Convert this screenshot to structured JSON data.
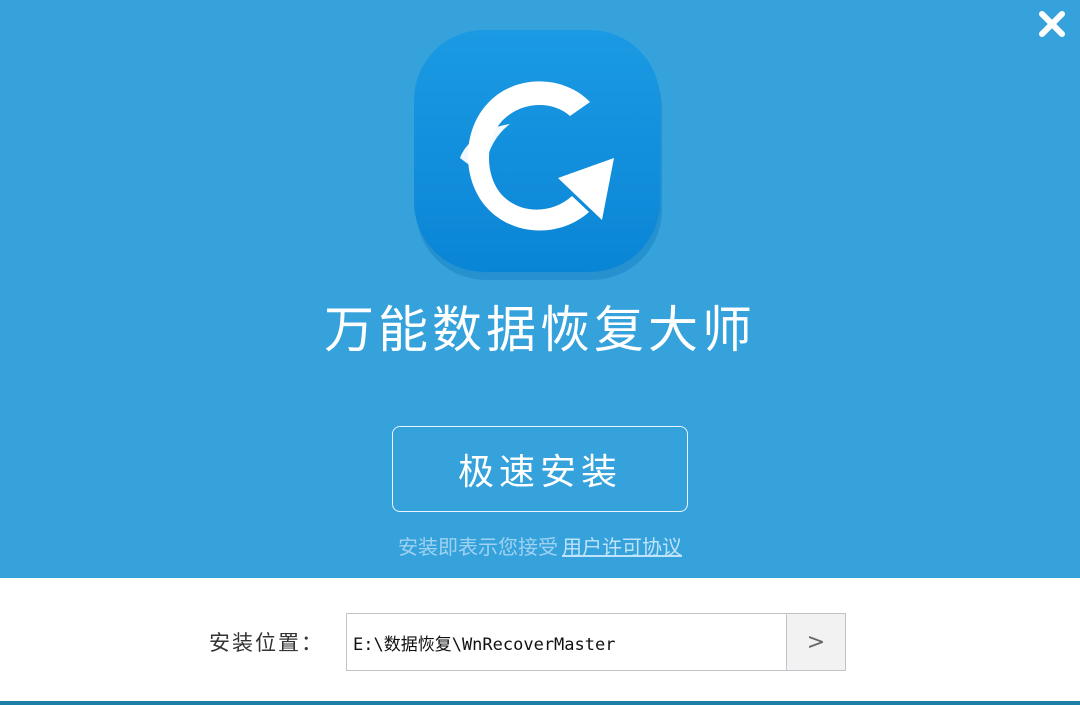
{
  "window": {
    "close_icon": "close-icon"
  },
  "header": {
    "app_icon": "refresh-recovery-icon",
    "title": "万能数据恢复大师"
  },
  "install": {
    "button_label": "极速安装",
    "agreement_text": "安装即表示您接受",
    "agreement_link": "用户许可协议"
  },
  "location": {
    "label": "安装位置：",
    "path": "E:\\数据恢复\\WnRecoverMaster",
    "browse_label": ">"
  },
  "colors": {
    "accent": "#35a2dc",
    "icon_tile": "#168fdc",
    "text_dark": "#333333"
  }
}
